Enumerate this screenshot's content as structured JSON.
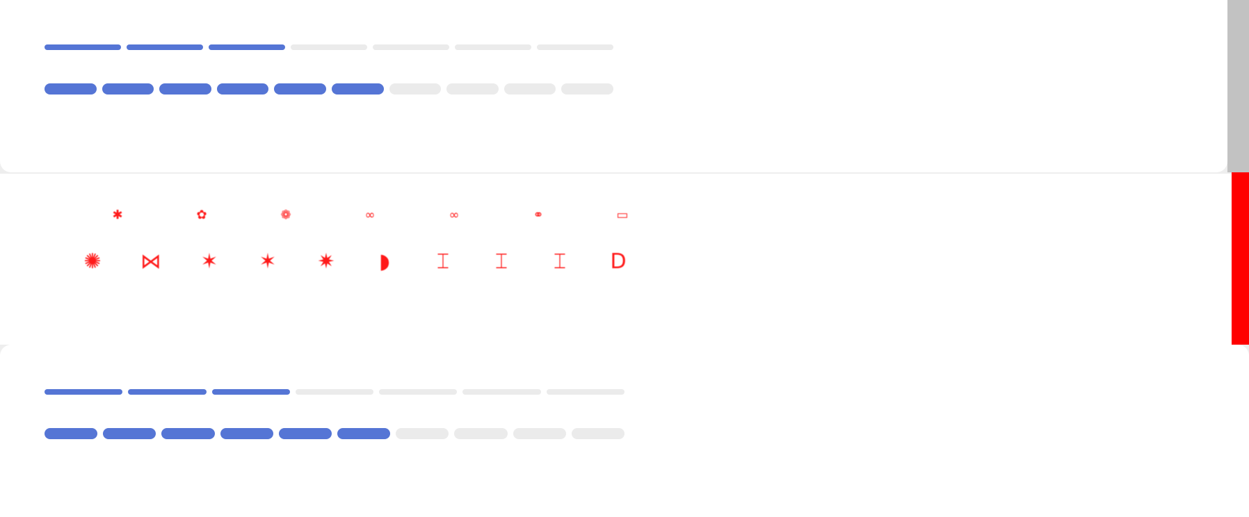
{
  "colors": {
    "active": "#5575d5",
    "inactive": "#ebebeb",
    "glyph": "#ff1a1a",
    "scrollbar_track": "#c2c2c2",
    "scrollbar_thumb": "#ff0000",
    "background": "#ffffff"
  },
  "progress_top": {
    "step_bar": {
      "total": 7,
      "completed": 3
    },
    "pill_bar": {
      "total": 10,
      "completed": 6
    }
  },
  "glyphs": {
    "row_small": [
      {
        "icon": "asterisk-icon",
        "char": "✱"
      },
      {
        "icon": "flower-icon",
        "char": "✿"
      },
      {
        "icon": "half-flower-icon",
        "char": "❁"
      },
      {
        "icon": "infinity-icon",
        "char": "∞"
      },
      {
        "icon": "infinity-icon",
        "char": "∞"
      },
      {
        "icon": "double-circle-icon",
        "char": "⚭"
      },
      {
        "icon": "rounded-rect-icon",
        "char": "▭"
      }
    ],
    "row_large": [
      {
        "icon": "asterisk-icon",
        "char": "✺"
      },
      {
        "icon": "bowtie-icon",
        "char": "⋈"
      },
      {
        "icon": "bowtie-filled-icon",
        "char": "✶"
      },
      {
        "icon": "bowtie-filled-icon",
        "char": "✶"
      },
      {
        "icon": "bowtie-filled-icon",
        "char": "✷"
      },
      {
        "icon": "half-bowtie-icon",
        "char": "◗"
      },
      {
        "icon": "bracket-pair-icon",
        "char": "⌶"
      },
      {
        "icon": "bracket-pair-icon",
        "char": "⌶"
      },
      {
        "icon": "bracket-pair-icon",
        "char": "⌶"
      },
      {
        "icon": "d-shape-icon",
        "char": "D"
      }
    ]
  },
  "progress_bottom": {
    "step_bar": {
      "total": 7,
      "completed": 3
    },
    "pill_bar": {
      "total": 10,
      "completed": 6
    }
  }
}
